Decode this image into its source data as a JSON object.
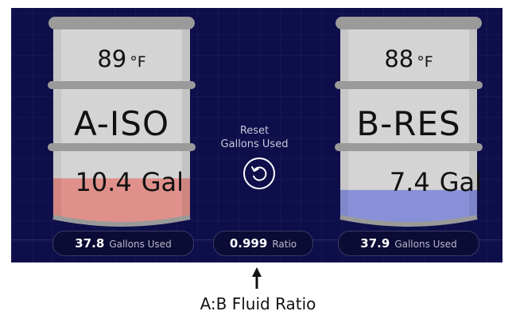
{
  "drums": {
    "a": {
      "temp_value": "89",
      "temp_unit": "°F",
      "name": "A-ISO",
      "gallons": "10.4",
      "gallon_unit": "Gal",
      "fill_color": "#e0908a",
      "level": 0.2
    },
    "b": {
      "temp_value": "88",
      "temp_unit": "°F",
      "name": "B-RES",
      "gallons": "7.4",
      "gallon_unit": "Gal",
      "fill_color": "#8890d8",
      "level": 0.14
    }
  },
  "reset": {
    "line1": "Reset",
    "line2": "Gallons Used",
    "icon": "reset-icon"
  },
  "stats": {
    "a_used_value": "37.8",
    "a_used_label": "Gallons Used",
    "ratio_value": "0.999",
    "ratio_label": "Ratio",
    "b_used_value": "37.9",
    "b_used_label": "Gallons Used"
  },
  "caption": "A:B Fluid Ratio",
  "colors": {
    "background": "#0e0e4a",
    "drum_body": "#d4d4d4",
    "drum_rim": "#9a9a9a"
  }
}
